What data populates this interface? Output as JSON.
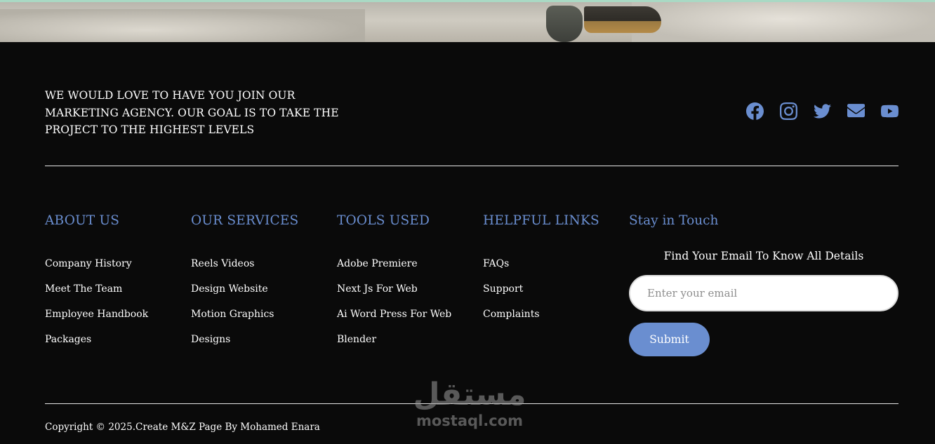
{
  "tagline": "WE WOULD LOVE TO HAVE YOU JOIN OUR MARKETING AGENCY. OUR GOAL IS TO TAKE THE PROJECT TO THE HIGHEST LEVELS",
  "socials": [
    "facebook-icon",
    "instagram-icon",
    "twitter-icon",
    "envelope-icon",
    "youtube-icon"
  ],
  "columns": {
    "about": {
      "title": "ABOUT US",
      "items": [
        "Company History",
        "Meet The Team",
        "Employee Handbook",
        "Packages"
      ]
    },
    "services": {
      "title": "OUR SERVICES",
      "items": [
        "Reels Videos",
        "Design Website",
        "Motion Graphics",
        "Designs"
      ]
    },
    "tools": {
      "title": "TOOLS USED",
      "items": [
        "Adobe Premiere",
        "Next Js For Web",
        "Ai Word Press For Web",
        "Blender"
      ]
    },
    "links": {
      "title": "HELPFUL LINKS",
      "items": [
        "FAQs",
        "Support",
        "Complaints"
      ]
    }
  },
  "touch": {
    "title": "Stay in Touch",
    "subtitle": "Find Your Email To Know All Details",
    "email_placeholder": "Enter your email",
    "submit_label": "Submit"
  },
  "copyright": "Copyright © 2025.Create M&Z Page By Mohamed Enara",
  "watermark": {
    "arabic": "مستقل",
    "latin": "mostaql.com"
  },
  "colors": {
    "accent": "#6a8ed0",
    "background": "#0a0a0a",
    "text": "#ffffff"
  }
}
